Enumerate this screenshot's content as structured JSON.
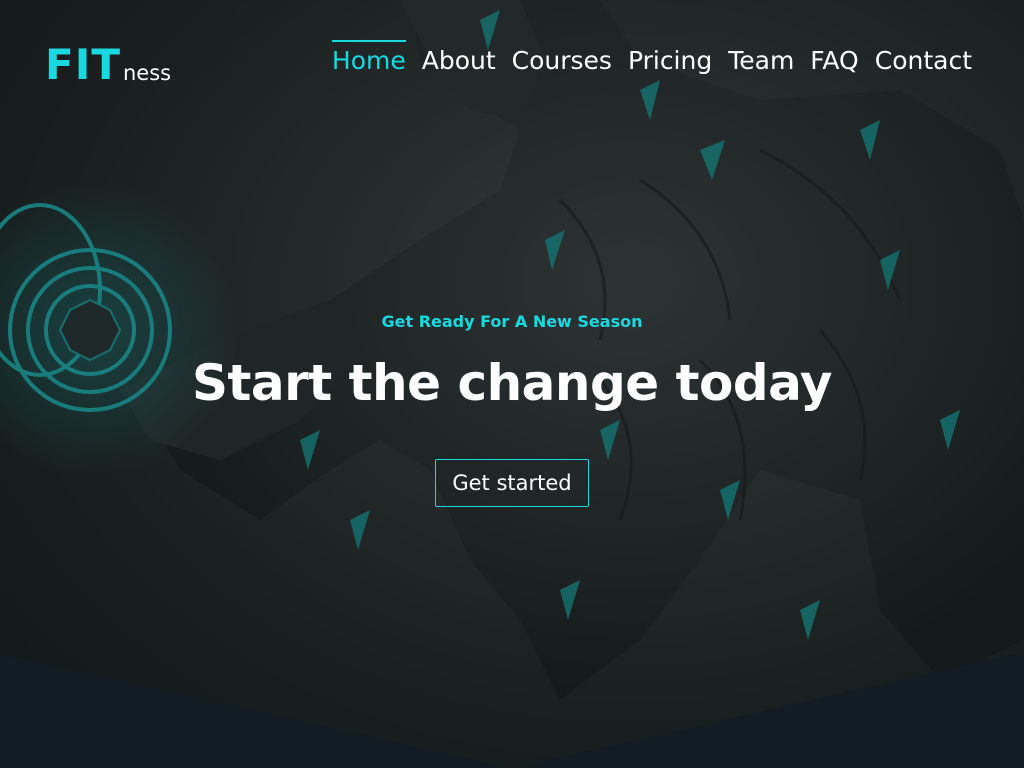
{
  "brand": {
    "logo_main": "FIT",
    "logo_suffix": "ness",
    "accent_color": "#18d8e0"
  },
  "nav": {
    "items": [
      {
        "label": "Home",
        "active": true
      },
      {
        "label": "About",
        "active": false
      },
      {
        "label": "Courses",
        "active": false
      },
      {
        "label": "Pricing",
        "active": false
      },
      {
        "label": "Team",
        "active": false
      },
      {
        "label": "FAQ",
        "active": false
      },
      {
        "label": "Contact",
        "active": false
      }
    ]
  },
  "hero": {
    "tagline": "Get Ready For A New Season",
    "headline": "Start the change today",
    "cta_label": "Get started",
    "background_image": "athlete-dumbbell-curl"
  },
  "colors": {
    "accent": "#18d8e0",
    "text": "#ffffff",
    "section_dark": "#121c25"
  }
}
